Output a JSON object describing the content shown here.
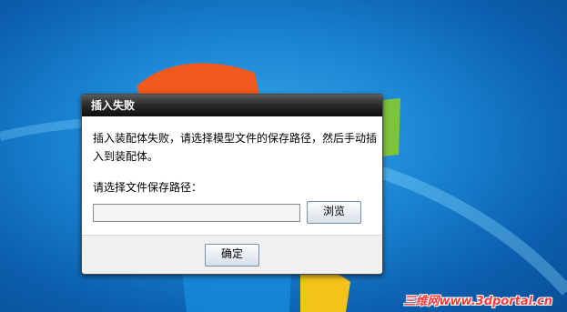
{
  "dialog": {
    "title": "插入失败",
    "message": "插入装配体失败，请选择模型文件的保存路径，然后手动插入到装配体。",
    "path_label": "请选择文件保存路径：",
    "path_value": "",
    "browse_label": "浏览",
    "ok_label": "确定"
  },
  "watermark": "三维网www.3dportal.cn",
  "colors": {
    "desktop_blue": "#1b86d4",
    "titlebar": "#1a1a1a",
    "watermark_red": "#ff3a3a"
  }
}
